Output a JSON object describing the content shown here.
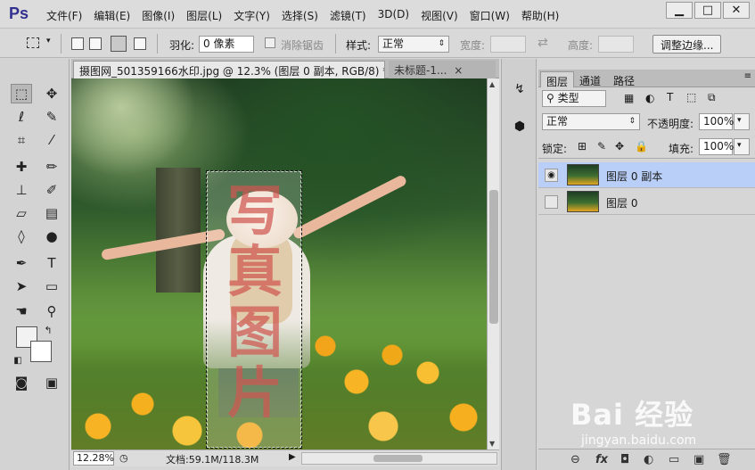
{
  "app": {
    "logo": "Ps"
  },
  "menu": [
    "文件(F)",
    "编辑(E)",
    "图像(I)",
    "图层(L)",
    "文字(Y)",
    "选择(S)",
    "滤镜(T)",
    "3D(D)",
    "视图(V)",
    "窗口(W)",
    "帮助(H)"
  ],
  "window_buttons": {
    "minimize": "▁",
    "restore": "□",
    "close": "✕"
  },
  "options": {
    "feather_label": "羽化:",
    "feather_value": "0 像素",
    "antialias_label": "消除锯齿",
    "style_label": "样式:",
    "style_value": "正常",
    "width_label": "宽度:",
    "height_label": "高度:",
    "refine_edge": "调整边缘..."
  },
  "tabs": [
    {
      "label": "摄图网_501359166水印.jpg @ 12.3% (图层 0 副本, RGB/8) *",
      "close": "×"
    },
    {
      "label": "未标题-1...",
      "close": "×"
    }
  ],
  "watermark_chars": [
    "写",
    "真",
    "图",
    "片"
  ],
  "status": {
    "zoom": "12.28%",
    "docinfo": "文档:59.1M/118.3M"
  },
  "layers_panel": {
    "tabs": [
      "图层",
      "通道",
      "路径"
    ],
    "filter_kind": "类型",
    "blend_mode": "正常",
    "opacity_label": "不透明度:",
    "opacity_value": "100%",
    "lock_label": "锁定:",
    "fill_label": "填充:",
    "fill_value": "100%",
    "layers": [
      {
        "name": "图层 0 副本",
        "visible": true,
        "selected": true
      },
      {
        "name": "图层 0",
        "visible": false,
        "selected": false
      }
    ]
  },
  "icons": {
    "eye": "eye-icon",
    "link": "link-icon",
    "fx": "fx-icon",
    "mask": "mask-icon",
    "adjust": "adjustment-icon",
    "folder": "folder-icon",
    "new_layer": "new-layer-icon",
    "trash": "trash-icon"
  },
  "footer_glyphs": {
    "link": "⊖",
    "fx": "fx",
    "mask": "◘",
    "adjust": "◐",
    "folder": "▭",
    "new_layer": "▣",
    "trash": "🗑"
  },
  "overlay": {
    "baidu": "Bai 经验",
    "sub": "jingyan.baidu.com"
  },
  "colors": {
    "selected_layer": "#b9cff7",
    "logo": "#31308e",
    "watermark": "#c42e26"
  }
}
